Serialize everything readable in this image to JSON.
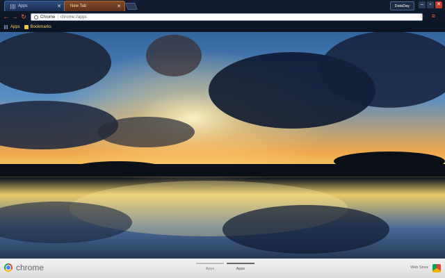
{
  "tabs": [
    {
      "title": "Apps",
      "active": true
    },
    {
      "title": "New Tab",
      "active": false
    }
  ],
  "profile": {
    "label": "DataDay"
  },
  "omnibox": {
    "scheme_label": "Chrome",
    "url": "chrome://apps"
  },
  "bookmarks": [
    {
      "label": "Apps",
      "icon": "apps-grid-icon"
    },
    {
      "label": "Bookmarks",
      "icon": "folder-icon"
    }
  ],
  "bottom": {
    "brand": "chrome",
    "pages": [
      "Apps",
      "Apps"
    ],
    "webstore": "Web Store"
  },
  "colors": {
    "accent": "#ff6a35",
    "tab_active": "#2b4a7a",
    "tab_other": "#7f4a2a"
  }
}
